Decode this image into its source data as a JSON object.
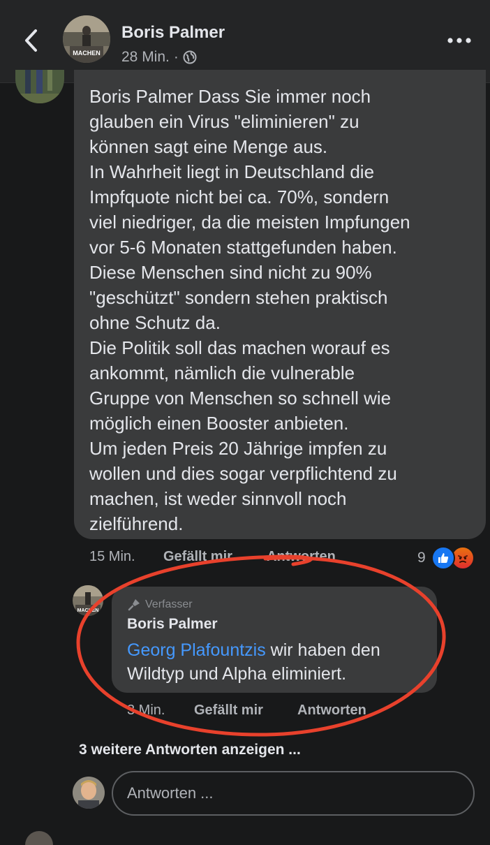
{
  "header": {
    "name": "Boris Palmer",
    "time": "28 Min.",
    "dot": "·",
    "avatar_label": "MACHEN"
  },
  "comment": {
    "text": "Boris Palmer Dass Sie immer noch\nglauben ein Virus \"eliminieren\" zu\nkönnen sagt eine Menge aus.\nIn Wahrheit liegt in Deutschland die\nImpfquote nicht bei ca. 70%, sondern\nviel niedriger, da die meisten Impfungen\nvor 5-6 Monaten stattgefunden haben.\nDiese Menschen sind nicht zu 90%\n\"geschützt\" sondern stehen praktisch\nohne Schutz da.\nDie Politik soll das machen worauf es\nankommt, nämlich die vulnerable\nGruppe von Menschen so schnell wie\nmöglich einen Booster anbieten.\nUm jeden Preis 20 Jährige impfen zu\nwollen und dies sogar verpflichtend zu\nmachen, ist weder sinnvoll noch\nzielführend.",
    "time": "15 Min.",
    "like_label": "Gefällt mir",
    "reply_label": "Antworten",
    "reaction_count": "9"
  },
  "reply": {
    "badge": "Verfasser",
    "name": "Boris Palmer",
    "mention": "Georg Plafountzis",
    "text": " wir haben den Wildtyp und Alpha eliminiert.",
    "time": "3 Min.",
    "like_label": "Gefällt mir",
    "reply_label": "Antworten",
    "avatar_label": "MACHEN"
  },
  "more_replies": "3 weitere Antworten anzeigen ...",
  "compose": {
    "placeholder": "Antworten ..."
  },
  "colors": {
    "background": "#18191a",
    "bubble": "#3a3b3c",
    "link": "#4599ff",
    "like_blue": "#1877f2",
    "annotation_red": "#e8412c"
  }
}
